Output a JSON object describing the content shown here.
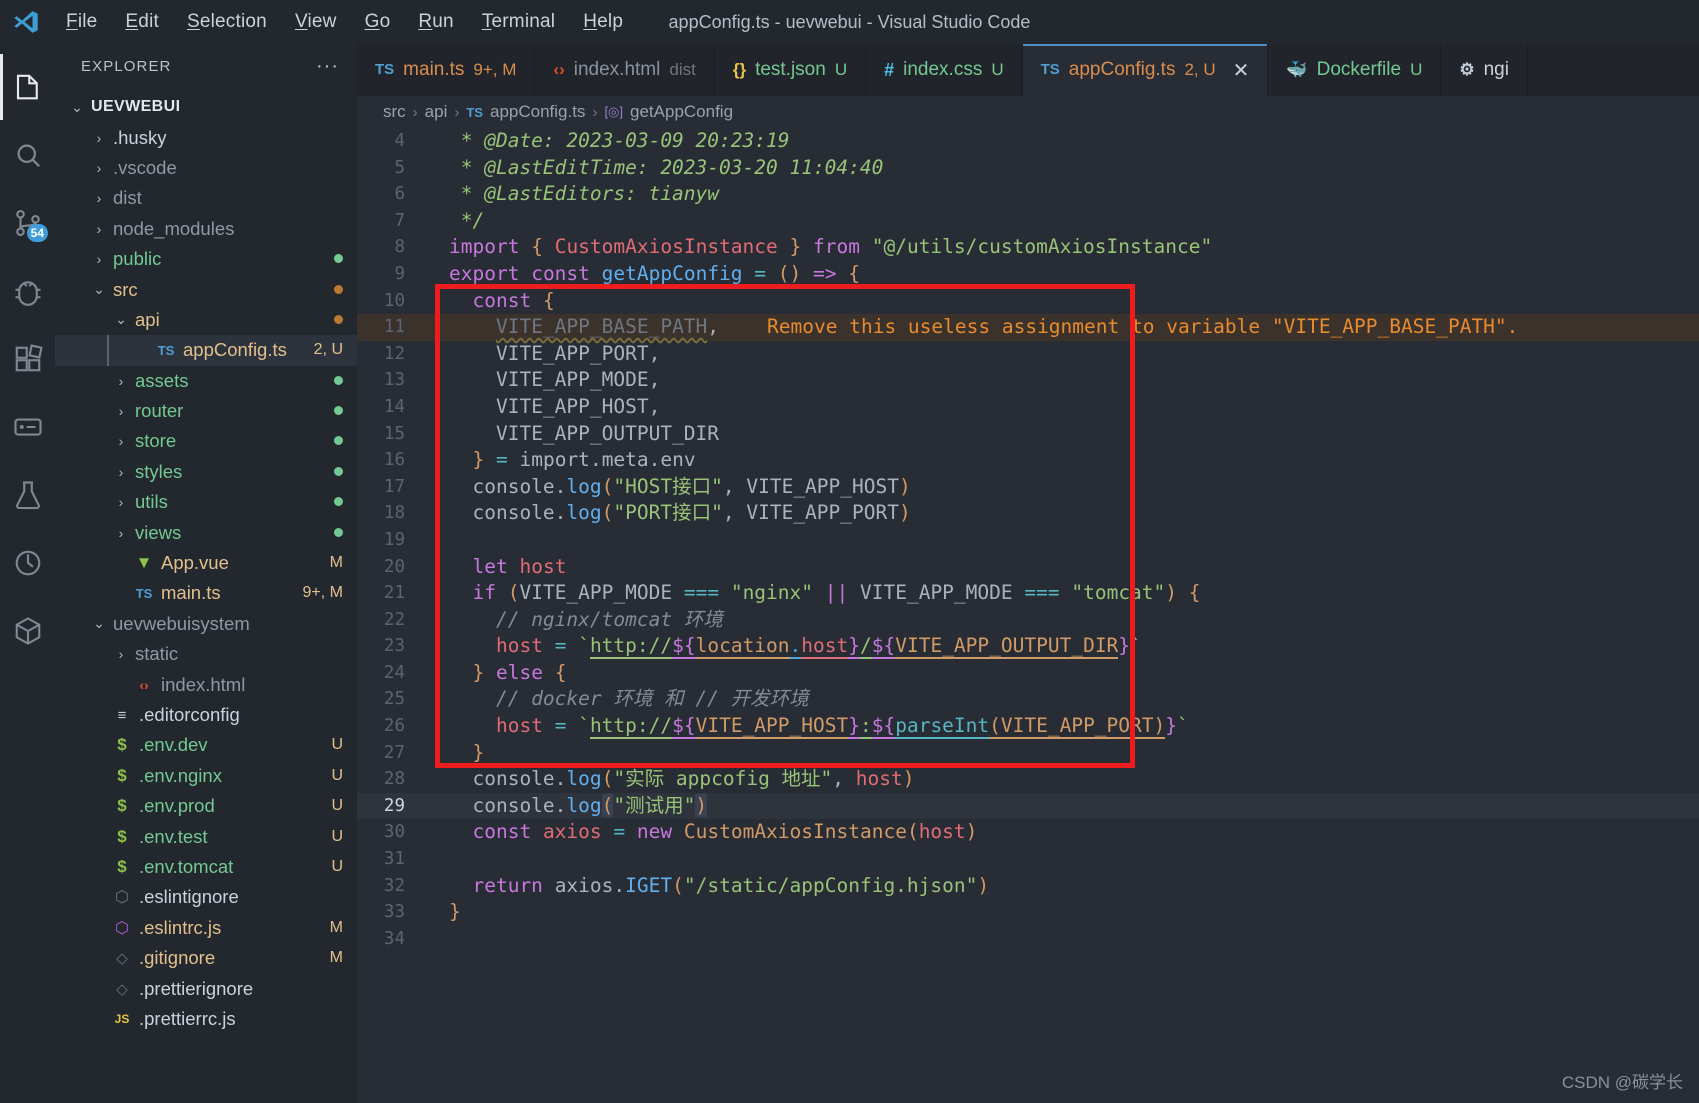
{
  "window": {
    "title": "appConfig.ts - uevwebui - Visual Studio Code",
    "logo_icon": "vscode-logo"
  },
  "menubar": {
    "items": [
      {
        "label": "File",
        "mnemonic": "F"
      },
      {
        "label": "Edit",
        "mnemonic": "E"
      },
      {
        "label": "Selection",
        "mnemonic": "S"
      },
      {
        "label": "View",
        "mnemonic": "V"
      },
      {
        "label": "Go",
        "mnemonic": "G"
      },
      {
        "label": "Run",
        "mnemonic": "R"
      },
      {
        "label": "Terminal",
        "mnemonic": "T"
      },
      {
        "label": "Help",
        "mnemonic": "H"
      }
    ]
  },
  "activitybar": {
    "items": [
      {
        "name": "explorer",
        "icon": "files-icon",
        "active": true,
        "badge": ""
      },
      {
        "name": "search",
        "icon": "search-icon",
        "active": false,
        "badge": ""
      },
      {
        "name": "source-control",
        "icon": "source-control-icon",
        "active": false,
        "badge": "54"
      },
      {
        "name": "run-and-debug",
        "icon": "debug-icon",
        "active": false,
        "badge": ""
      },
      {
        "name": "extensions",
        "icon": "extensions-icon",
        "active": false,
        "badge": ""
      },
      {
        "name": "remote-explorer",
        "icon": "remote-icon",
        "active": false,
        "badge": ""
      },
      {
        "name": "testing",
        "icon": "beaker-icon",
        "active": false,
        "badge": ""
      },
      {
        "name": "coverage",
        "icon": "circle-icon",
        "active": false,
        "badge": ""
      },
      {
        "name": "docker",
        "icon": "box-icon",
        "active": false,
        "badge": ""
      }
    ]
  },
  "sidebar": {
    "title": "EXPLORER",
    "more_actions": "···",
    "root": {
      "label": "UEVWEBUI",
      "chevron": "⌄"
    },
    "tree": [
      {
        "label": ".husky",
        "indent": 1,
        "chevron": "right",
        "kind": "folder",
        "color": "plain",
        "badge": "",
        "dot": ""
      },
      {
        "label": ".vscode",
        "indent": 1,
        "chevron": "right",
        "kind": "folder",
        "color": "dim",
        "badge": "",
        "dot": ""
      },
      {
        "label": "dist",
        "indent": 1,
        "chevron": "right",
        "kind": "folder",
        "color": "dim",
        "badge": "",
        "dot": ""
      },
      {
        "label": "node_modules",
        "indent": 1,
        "chevron": "right",
        "kind": "folder",
        "color": "dim",
        "badge": "",
        "dot": ""
      },
      {
        "label": "public",
        "indent": 1,
        "chevron": "right",
        "kind": "folder",
        "color": "green",
        "badge": "",
        "dot": "g"
      },
      {
        "label": "src",
        "indent": 1,
        "chevron": "down",
        "kind": "folder",
        "color": "orange",
        "badge": "",
        "dot": "o"
      },
      {
        "label": "api",
        "indent": 2,
        "chevron": "down",
        "kind": "folder",
        "color": "orange",
        "badge": "",
        "dot": "o"
      },
      {
        "label": "appConfig.ts",
        "indent": 3,
        "chevron": "none",
        "kind": "ts",
        "color": "orange",
        "badge": "2, U",
        "dot": "",
        "selected": true
      },
      {
        "label": "assets",
        "indent": 2,
        "chevron": "right",
        "kind": "folder",
        "color": "green",
        "badge": "",
        "dot": "g"
      },
      {
        "label": "router",
        "indent": 2,
        "chevron": "right",
        "kind": "folder",
        "color": "green",
        "badge": "",
        "dot": "g"
      },
      {
        "label": "store",
        "indent": 2,
        "chevron": "right",
        "kind": "folder",
        "color": "green",
        "badge": "",
        "dot": "g"
      },
      {
        "label": "styles",
        "indent": 2,
        "chevron": "right",
        "kind": "folder",
        "color": "green",
        "badge": "",
        "dot": "g"
      },
      {
        "label": "utils",
        "indent": 2,
        "chevron": "right",
        "kind": "folder",
        "color": "green",
        "badge": "",
        "dot": "g"
      },
      {
        "label": "views",
        "indent": 2,
        "chevron": "right",
        "kind": "folder",
        "color": "green",
        "badge": "",
        "dot": "g"
      },
      {
        "label": "App.vue",
        "indent": 2,
        "chevron": "none",
        "kind": "vue",
        "color": "orange",
        "badge": "M",
        "dot": ""
      },
      {
        "label": "main.ts",
        "indent": 2,
        "chevron": "none",
        "kind": "ts",
        "color": "orange",
        "badge": "9+, M",
        "dot": ""
      },
      {
        "label": "uevwebuisystem",
        "indent": 1,
        "chevron": "down",
        "kind": "folder",
        "color": "dim",
        "badge": "",
        "dot": ""
      },
      {
        "label": "static",
        "indent": 2,
        "chevron": "right",
        "kind": "folder",
        "color": "dim",
        "badge": "",
        "dot": ""
      },
      {
        "label": "index.html",
        "indent": 2,
        "chevron": "none",
        "kind": "html",
        "color": "dim",
        "badge": "",
        "dot": ""
      },
      {
        "label": ".editorconfig",
        "indent": 1,
        "chevron": "none",
        "kind": "config",
        "color": "plain",
        "badge": "",
        "dot": ""
      },
      {
        "label": ".env.dev",
        "indent": 1,
        "chevron": "none",
        "kind": "env",
        "color": "green",
        "badge": "U",
        "dot": ""
      },
      {
        "label": ".env.nginx",
        "indent": 1,
        "chevron": "none",
        "kind": "env",
        "color": "green",
        "badge": "U",
        "dot": ""
      },
      {
        "label": ".env.prod",
        "indent": 1,
        "chevron": "none",
        "kind": "env",
        "color": "green",
        "badge": "U",
        "dot": ""
      },
      {
        "label": ".env.test",
        "indent": 1,
        "chevron": "none",
        "kind": "env",
        "color": "green",
        "badge": "U",
        "dot": ""
      },
      {
        "label": ".env.tomcat",
        "indent": 1,
        "chevron": "none",
        "kind": "env",
        "color": "green",
        "badge": "U",
        "dot": ""
      },
      {
        "label": ".eslintignore",
        "indent": 1,
        "chevron": "none",
        "kind": "eslint-gray",
        "color": "plain",
        "badge": "",
        "dot": ""
      },
      {
        "label": ".eslintrc.js",
        "indent": 1,
        "chevron": "none",
        "kind": "eslint",
        "color": "orange",
        "badge": "M",
        "dot": ""
      },
      {
        "label": ".gitignore",
        "indent": 1,
        "chevron": "none",
        "kind": "git",
        "color": "orange",
        "badge": "M",
        "dot": ""
      },
      {
        "label": ".prettierignore",
        "indent": 1,
        "chevron": "none",
        "kind": "git",
        "color": "plain",
        "badge": "",
        "dot": ""
      },
      {
        "label": ".prettierrc.js",
        "indent": 1,
        "chevron": "none",
        "kind": "js",
        "color": "plain",
        "badge": "",
        "dot": ""
      }
    ]
  },
  "tabs": [
    {
      "icon": "ts-icon",
      "name": "main.ts",
      "sub": "9+, M",
      "active": false,
      "closable": false
    },
    {
      "icon": "html-icon",
      "name": "index.html",
      "sub": "dist",
      "active": false,
      "closable": false
    },
    {
      "icon": "json-icon",
      "name": "test.json",
      "sub": "U",
      "active": false,
      "closable": false
    },
    {
      "icon": "css-icon",
      "name": "index.css",
      "sub": "U",
      "active": false,
      "closable": false
    },
    {
      "icon": "ts-icon",
      "name": "appConfig.ts",
      "sub": "2, U",
      "active": true,
      "closable": true,
      "close": "✕"
    },
    {
      "icon": "docker-icon",
      "name": "Dockerfile",
      "sub": "U",
      "active": false,
      "closable": false
    },
    {
      "icon": "gear-icon",
      "name": "ngi",
      "sub": "",
      "active": false,
      "closable": false
    }
  ],
  "breadcrumb": {
    "parts": [
      "src",
      "api",
      "appConfig.ts",
      "getAppConfig"
    ],
    "separator": "›",
    "file_icon": "TS",
    "symbol_icon": "[◎]"
  },
  "editor": {
    "language": "typescript",
    "current_line": 29,
    "inline_hint": "Remove this useless assignment to variable \"VITE_APP_BASE_PATH\".",
    "annotation_box_color": "#ee1c1c",
    "lines": [
      {
        "n": 4,
        "text": " * @Date: 2023-03-09 20:23:19"
      },
      {
        "n": 5,
        "text": " * @LastEditTime: 2023-03-20 11:04:40"
      },
      {
        "n": 6,
        "text": " * @LastEditors: tianyw"
      },
      {
        "n": 7,
        "text": " */"
      },
      {
        "n": 8,
        "text": "import { CustomAxiosInstance } from \"@/utils/customAxiosInstance\""
      },
      {
        "n": 9,
        "text": "export const getAppConfig = () => {"
      },
      {
        "n": 10,
        "text": "  const {"
      },
      {
        "n": 11,
        "text": "    VITE_APP_BASE_PATH,"
      },
      {
        "n": 12,
        "text": "    VITE_APP_PORT,"
      },
      {
        "n": 13,
        "text": "    VITE_APP_MODE,"
      },
      {
        "n": 14,
        "text": "    VITE_APP_HOST,"
      },
      {
        "n": 15,
        "text": "    VITE_APP_OUTPUT_DIR"
      },
      {
        "n": 16,
        "text": "  } = import.meta.env"
      },
      {
        "n": 17,
        "text": "  console.log(\"HOST接口\", VITE_APP_HOST)"
      },
      {
        "n": 18,
        "text": "  console.log(\"PORT接口\", VITE_APP_PORT)"
      },
      {
        "n": 19,
        "text": ""
      },
      {
        "n": 20,
        "text": "  let host"
      },
      {
        "n": 21,
        "text": "  if (VITE_APP_MODE === \"nginx\" || VITE_APP_MODE === \"tomcat\") {"
      },
      {
        "n": 22,
        "text": "    // nginx/tomcat 环境"
      },
      {
        "n": 23,
        "text": "    host = `http://${location.host}/${VITE_APP_OUTPUT_DIR}`"
      },
      {
        "n": 24,
        "text": "  } else {"
      },
      {
        "n": 25,
        "text": "    // docker 环境 和 // 开发环境"
      },
      {
        "n": 26,
        "text": "    host = `http://${VITE_APP_HOST}:${parseInt(VITE_APP_PORT)}`"
      },
      {
        "n": 27,
        "text": "  }"
      },
      {
        "n": 28,
        "text": "  console.log(\"实际 appcofig 地址\", host)"
      },
      {
        "n": 29,
        "text": "  console.log(\"测试用\")"
      },
      {
        "n": 30,
        "text": "  const axios = new CustomAxiosInstance(host)"
      },
      {
        "n": 31,
        "text": ""
      },
      {
        "n": 32,
        "text": "  return axios.IGET(\"/static/appConfig.hjson\")"
      },
      {
        "n": 33,
        "text": "}"
      },
      {
        "n": 34,
        "text": ""
      }
    ]
  },
  "watermark": "CSDN @碳学长"
}
